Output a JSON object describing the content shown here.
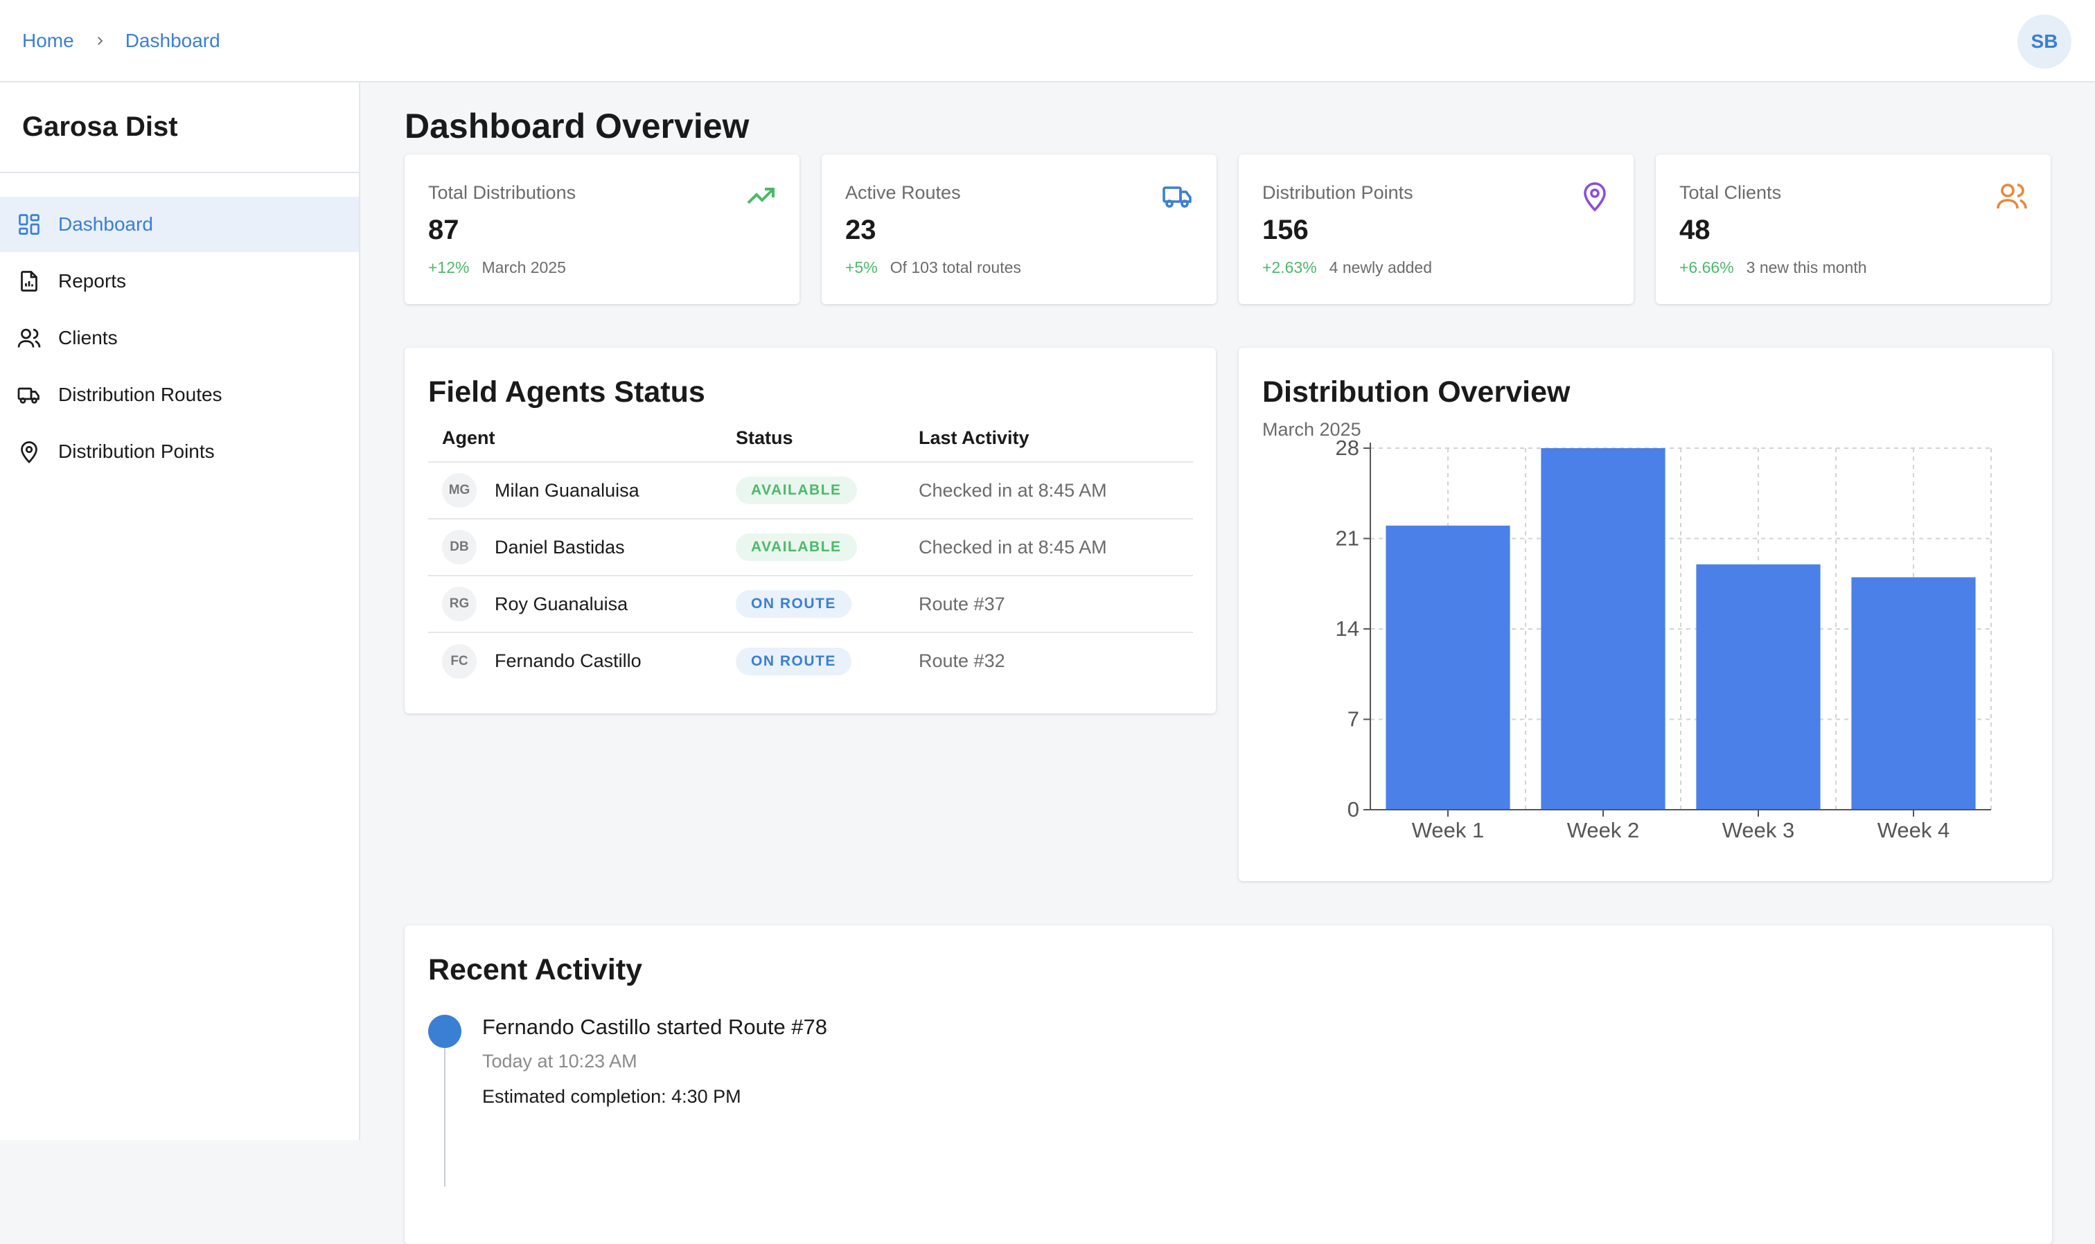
{
  "breadcrumb": {
    "home": "Home",
    "current": "Dashboard"
  },
  "user": {
    "initials": "SB"
  },
  "sidebar": {
    "brand": "Garosa Dist",
    "items": [
      {
        "label": "Dashboard",
        "icon": "dashboard-grid-icon",
        "active": true
      },
      {
        "label": "Reports",
        "icon": "report-document-icon"
      },
      {
        "label": "Clients",
        "icon": "users-icon"
      },
      {
        "label": "Distribution Routes",
        "icon": "truck-icon"
      },
      {
        "label": "Distribution Points",
        "icon": "map-pin-icon"
      }
    ]
  },
  "page": {
    "title": "Dashboard Overview"
  },
  "stats": [
    {
      "label": "Total Distributions",
      "value": "87",
      "delta": "+12%",
      "note": "March 2025",
      "icon": "trending-up-icon",
      "color": "#4cb96a"
    },
    {
      "label": "Active Routes",
      "value": "23",
      "delta": "+5%",
      "note": "Of 103 total routes",
      "icon": "truck-icon",
      "color": "#3a7fd4"
    },
    {
      "label": "Distribution Points",
      "value": "156",
      "delta": "+2.63%",
      "note": "4 newly added",
      "icon": "map-pin-icon",
      "color": "#8a4fd8"
    },
    {
      "label": "Total Clients",
      "value": "48",
      "delta": "+6.66%",
      "note": "3 new this month",
      "icon": "users-icon",
      "color": "#e8873a"
    }
  ],
  "agents": {
    "title": "Field Agents Status",
    "columns": [
      "Agent",
      "Status",
      "Last Activity"
    ],
    "rows": [
      {
        "initials": "MG",
        "name": "Milan Guanaluisa",
        "status": "AVAILABLE",
        "activity": "Checked in at 8:45 AM"
      },
      {
        "initials": "DB",
        "name": "Daniel Bastidas",
        "status": "AVAILABLE",
        "activity": "Checked in at 8:45 AM"
      },
      {
        "initials": "RG",
        "name": "Roy Guanaluisa",
        "status": "ON ROUTE",
        "activity": "Route #37"
      },
      {
        "initials": "FC",
        "name": "Fernando Castillo",
        "status": "ON ROUTE",
        "activity": "Route #32"
      }
    ]
  },
  "overview": {
    "title": "Distribution Overview",
    "subtitle": "March 2025"
  },
  "chart_data": {
    "type": "bar",
    "categories": [
      "Week 1",
      "Week 2",
      "Week 3",
      "Week 4"
    ],
    "values": [
      22,
      28,
      19,
      18
    ],
    "yticks": [
      0,
      7,
      14,
      21,
      28
    ],
    "ylim": [
      0,
      28
    ],
    "grid": true,
    "bar_color": "#4a80e8",
    "title": "Distribution Overview",
    "subtitle": "March 2025"
  },
  "recent": {
    "title": "Recent Activity",
    "items": [
      {
        "title": "Fernando Castillo started Route #78",
        "time": "Today at 10:23 AM",
        "detail": "Estimated completion: 4:30 PM"
      }
    ]
  }
}
